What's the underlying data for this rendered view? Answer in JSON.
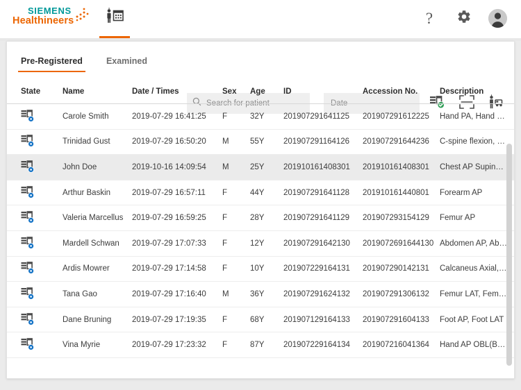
{
  "appbar": {
    "logo_siemens": "SIEMENS",
    "logo_healthineers": "Healthineers",
    "module_tab_icon": "person-calendar-icon",
    "help_label": "?",
    "settings_icon": "gear-icon",
    "avatar_icon": "user-avatar-icon",
    "accent_color": "#ec6602",
    "siemens_teal": "#009999"
  },
  "toolbar": {
    "tabs": [
      {
        "label": "Pre-Registered",
        "active": true
      },
      {
        "label": "Examined",
        "active": false
      }
    ],
    "search": {
      "placeholder": "Search for patient",
      "value": "",
      "icon": "search-icon"
    },
    "date": {
      "placeholder": "Date",
      "value": ""
    },
    "actions": [
      {
        "name": "worklist-sync-icon",
        "title": "Worklist loaded"
      },
      {
        "name": "scan-barcode-icon",
        "title": "Scan"
      },
      {
        "name": "patient-transport-icon",
        "title": "Transport"
      }
    ],
    "badge_color": "#34a853"
  },
  "table": {
    "columns": [
      "State",
      "Name",
      "Date / Times",
      "Sex",
      "Age",
      "ID",
      "Accession No.",
      "Description"
    ],
    "state_icon": "registered-document-icon",
    "rows": [
      {
        "name": "Carole Smith",
        "date": "2019-07-29 16:41:25",
        "sex": "F",
        "age": "32Y",
        "id": "201907291641125",
        "accession": "201907291612225",
        "description": "Hand PA, Hand LAT",
        "selected": false
      },
      {
        "name": "Trinidad Gust",
        "date": "2019-07-29 16:50:20",
        "sex": "M",
        "age": "55Y",
        "id": "201907291164126",
        "accession": "201907291644236",
        "description": "C-spine flexion, C-s...",
        "selected": false
      },
      {
        "name": "John Doe",
        "date": "2019-10-16 14:09:54",
        "sex": "M",
        "age": "25Y",
        "id": "201910161408301",
        "accession": "201910161408301",
        "description": "Chest AP Supine, C...",
        "selected": true
      },
      {
        "name": "Arthur Baskin",
        "date": "2019-07-29 16:57:11",
        "sex": "F",
        "age": "44Y",
        "id": "201907291641128",
        "accession": "201910161440801",
        "description": "Forearm AP",
        "selected": false
      },
      {
        "name": "Valeria Marcellus",
        "date": "2019-07-29 16:59:25",
        "sex": "F",
        "age": "28Y",
        "id": "201907291641129",
        "accession": "201907293154129",
        "description": "Femur AP",
        "selected": false
      },
      {
        "name": "Mardell Schwan",
        "date": "2019-07-29 17:07:33",
        "sex": "F",
        "age": "12Y",
        "id": "201907291642130",
        "accession": "2019072691644130",
        "description": "Abdomen AP, Abdo...",
        "selected": false
      },
      {
        "name": "Ardis Mowrer",
        "date": "2019-07-29 17:14:58",
        "sex": "F",
        "age": "10Y",
        "id": "201907229164131",
        "accession": "201907290142131",
        "description": "Calcaneus Axial, An...",
        "selected": false
      },
      {
        "name": "Tana Gao",
        "date": "2019-07-29 17:16:40",
        "sex": "M",
        "age": "36Y",
        "id": "201907291624132",
        "accession": "201907291306132",
        "description": "Femur LAT, Femur ...",
        "selected": false
      },
      {
        "name": "Dane Bruning",
        "date": "2019-07-29 17:19:35",
        "sex": "F",
        "age": "68Y",
        "id": "201907129164133",
        "accession": "201907291604133",
        "description": "Foot AP, Foot LAT",
        "selected": false
      },
      {
        "name": "Vina Myrie",
        "date": "2019-07-29 17:23:32",
        "sex": "F",
        "age": "87Y",
        "id": "201907229164134",
        "accession": "201907216041364",
        "description": "Hand AP OBL(Ball C...",
        "selected": false
      }
    ]
  }
}
